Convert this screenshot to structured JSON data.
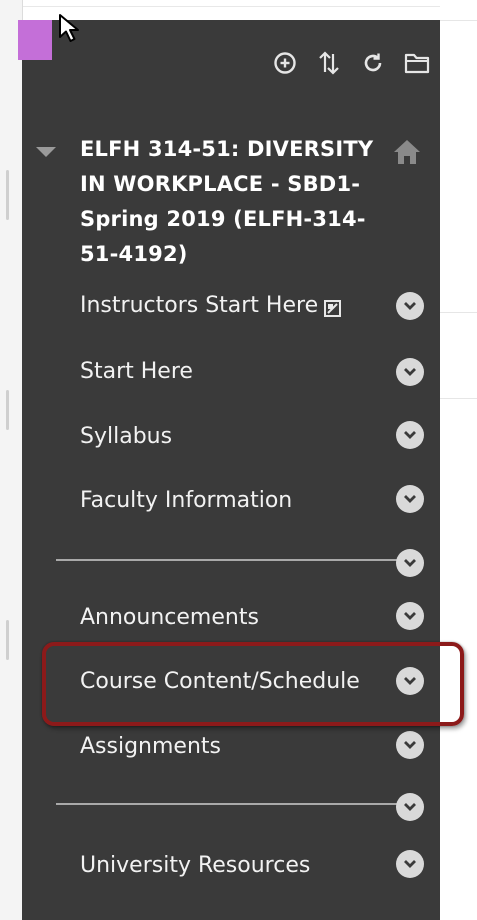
{
  "toolbar": {
    "icons": [
      "add-circle-icon",
      "reorder-arrows-icon",
      "refresh-icon",
      "folder-icon"
    ]
  },
  "course": {
    "title_lines": [
      "ELFH 314-51: DIVERSITY",
      "IN WORKPLACE - SBD1-",
      "Spring 2019 (ELFH-314-",
      "51-4192)"
    ]
  },
  "nav": {
    "items": [
      {
        "label": "Instructors Start Here",
        "has_external_icon": true
      },
      {
        "label": "Start Here"
      },
      {
        "label": "Syllabus"
      },
      {
        "label": "Faculty Information"
      },
      {
        "label": "Announcements"
      },
      {
        "label": "Course Content/Schedule",
        "highlighted": true
      },
      {
        "label": "Assignments"
      },
      {
        "label": "University Resources"
      }
    ]
  },
  "colors": {
    "menu_bg": "#3a3a3a",
    "accent": "#c46fd8",
    "highlight_border": "#8c1a1a",
    "chevron_bg": "#d9d9d9"
  }
}
